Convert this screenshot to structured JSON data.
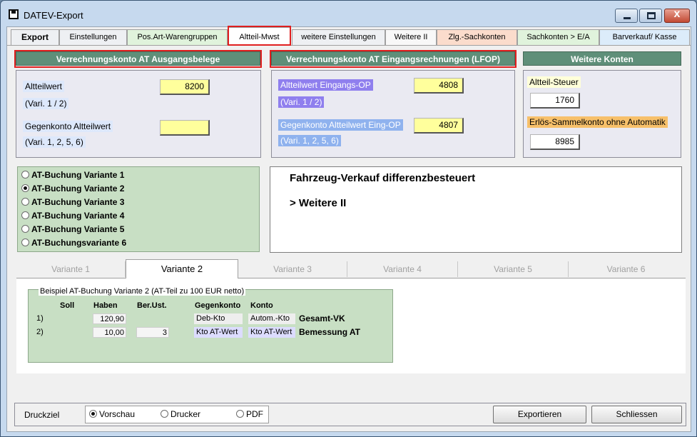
{
  "window": {
    "title": "DATEV-Export",
    "close_symbol": "x"
  },
  "tabs": [
    {
      "label": "Export",
      "color": "#eef0f3",
      "bold": true
    },
    {
      "label": "Einstellungen",
      "color": "#eef0f3"
    },
    {
      "label": "Pos.Art-Warengruppen",
      "color": "#e0f3dc"
    },
    {
      "label": "Altteil-Mwst",
      "color": "#ffffff",
      "active": true
    },
    {
      "label": "weitere Einstellungen",
      "color": "#eef0f3"
    },
    {
      "label": "Weitere II",
      "color": "#f8f8f8"
    },
    {
      "label": "Zlg.-Sachkonten",
      "color": "#fbdccc"
    },
    {
      "label": "Sachkonten > E/A",
      "color": "#e0f3dc"
    },
    {
      "label": "Barverkauf/ Kasse",
      "color": "#dcecfa"
    }
  ],
  "sections": {
    "ausgang": {
      "header": "Verrechnungskonto AT Ausgangsbelege",
      "altteilwert_label": "Altteilwert",
      "altteilwert_value": "8200",
      "vari_1": "(Vari. 1 / 2)",
      "gegenkonto_label": "Gegenkonto Altteilwert",
      "gegenkonto_value": "",
      "vari_2": "(Vari. 1, 2, 5, 6)"
    },
    "eingang": {
      "header": "Verrechnungskonto AT Eingangsrechnungen (LFOP)",
      "altteilwert_label": "Altteilwert Eingangs-OP",
      "altteilwert_value": "4808",
      "vari_1": "(Vari. 1 / 2)",
      "gegenkonto_label": "Gegenkonto Altteilwert Eing-OP",
      "gegenkonto_value": "4807",
      "vari_2": "(Vari. 1, 2, 5, 6)"
    },
    "weitere": {
      "header": "Weitere Konten",
      "steuer_label": "Altteil-Steuer",
      "steuer_value": "1760",
      "erloes_label": "Erlös-Sammelkonto ohne Automatik",
      "erloes_value": "8985"
    }
  },
  "colors": {
    "header_green": "#5f8f79",
    "field_yellow": "#ffff9c",
    "radio_green": "#c8dfc4",
    "highlight_red": "#e01f1f",
    "label_blue": "#dde8fb",
    "label_purple": "#8f7fee",
    "label_lightblue": "#8fb2ee",
    "label_orange": "#f7c06a"
  },
  "variants": {
    "options": [
      {
        "label": "AT-Buchung Variante 1",
        "checked": false
      },
      {
        "label": "AT-Buchung Variante 2",
        "checked": true
      },
      {
        "label": "AT-Buchung Variante 3",
        "checked": false
      },
      {
        "label": "AT-Buchung Variante 4",
        "checked": false
      },
      {
        "label": "AT-Buchung Variante 5",
        "checked": false
      },
      {
        "label": "AT-Buchungsvariante 6",
        "checked": false
      }
    ]
  },
  "description": {
    "line1": "Fahrzeug-Verkauf differenzbesteuert",
    "line2": "> Weitere II"
  },
  "variant_tabs": [
    {
      "label": "Variante 1",
      "active": false
    },
    {
      "label": "Variante 2",
      "active": true
    },
    {
      "label": "Variante 3",
      "active": false
    },
    {
      "label": "Variante 4",
      "active": false
    },
    {
      "label": "Variante 5",
      "active": false
    },
    {
      "label": "Variante 6",
      "active": false
    }
  ],
  "example": {
    "title": "Beispiel AT-Buchung Variante 2 (AT-Teil zu 100 EUR netto)",
    "columns": [
      "Soll",
      "Haben",
      "Ber.Ust.",
      "Gegenkonto",
      "Konto"
    ],
    "rows": [
      {
        "num": "1)",
        "soll": "",
        "haben": "120,90",
        "berust": "",
        "gegenkonto": "Deb-Kto",
        "konto": "Autom.-Kto",
        "note": "Gesamt-VK"
      },
      {
        "num": "2)",
        "soll": "",
        "haben": "10,00",
        "berust": "3",
        "gegenkonto": "Kto AT-Wert",
        "konto": "Kto AT-Wert",
        "note": "Bemessung AT"
      }
    ]
  },
  "bottom": {
    "druckziel_label": "Druckziel",
    "options": [
      {
        "label": "Vorschau",
        "checked": true
      },
      {
        "label": "Drucker",
        "checked": false
      },
      {
        "label": "PDF",
        "checked": false
      }
    ],
    "export_button": "Exportieren",
    "close_button": "Schliessen"
  }
}
